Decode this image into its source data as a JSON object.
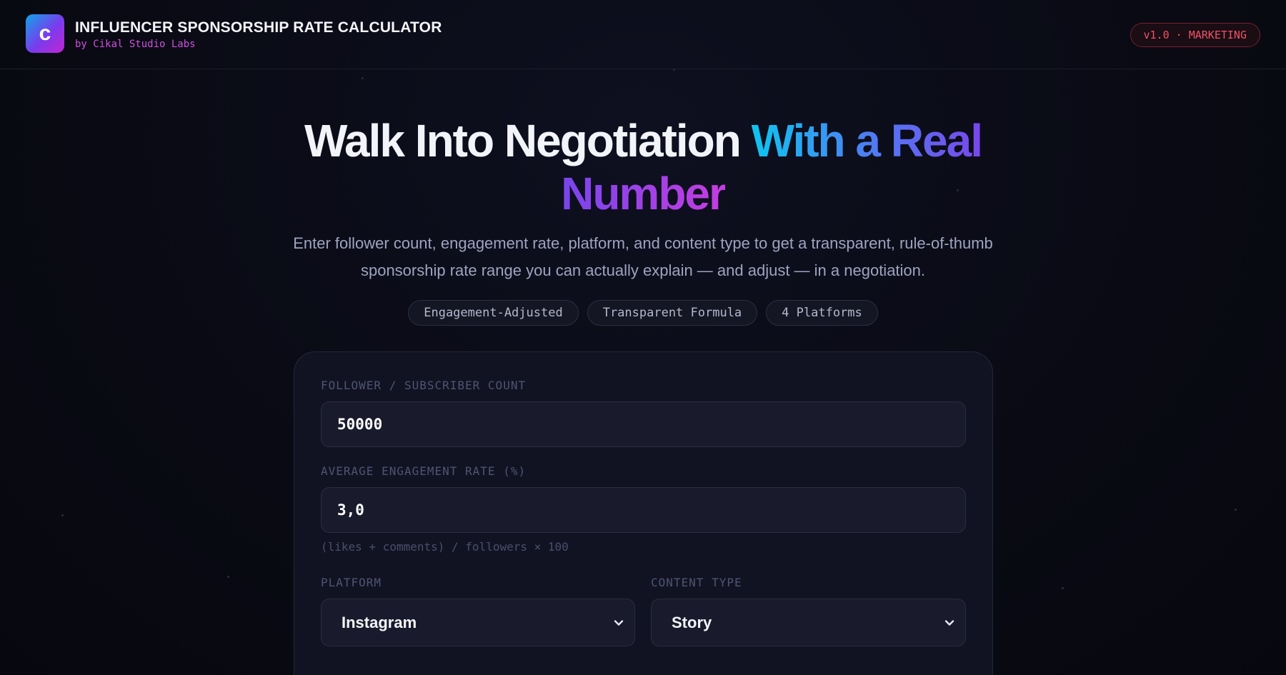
{
  "header": {
    "logo_letter": "c",
    "title": "INFLUENCER SPONSORSHIP RATE CALCULATOR",
    "subtitle": "by Cikal Studio Labs",
    "version_badge": "v1.0 · MARKETING"
  },
  "hero": {
    "title_plain": "Walk Into Negotiation",
    "title_highlight_1": "With a Real",
    "title_highlight_2": "Number",
    "description_line_1": "Enter follower count, engagement rate, platform, and content type to get a transparent, rule-of-thumb",
    "description_line_2": "sponsorship rate range you can actually explain — and adjust — in a negotiation.",
    "tags": [
      "Engagement-Adjusted",
      "Transparent Formula",
      "4 Platforms"
    ]
  },
  "form": {
    "followers": {
      "label": "FOLLOWER / SUBSCRIBER COUNT",
      "value": "50000"
    },
    "engagement": {
      "label": "AVERAGE ENGAGEMENT RATE (%)",
      "value": "3,0",
      "hint": "(likes + comments) / followers × 100"
    },
    "platform": {
      "label": "PLATFORM",
      "selected": "Instagram"
    },
    "content_type": {
      "label": "CONTENT TYPE",
      "selected": "Story"
    }
  },
  "colors": {
    "background": "#0a0b14",
    "accent_cyan": "#0ec5f0",
    "accent_purple": "#7b45ec",
    "accent_magenta": "#c53de0",
    "badge_red": "#f05266"
  }
}
